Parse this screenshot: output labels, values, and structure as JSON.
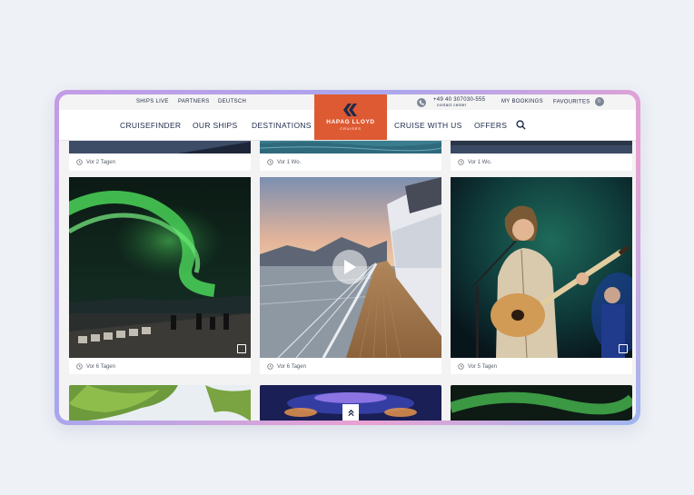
{
  "topbar": {
    "ships_live": "SHIPS LIVE",
    "partners": "PARTNERS",
    "language": "DEUTSCH",
    "phone_number": "+49 40 307030-555",
    "contact_center": "contact center",
    "my_bookings": "MY BOOKINGS",
    "favourites": "FAVOURITES",
    "favourites_count": "0"
  },
  "nav": {
    "cruisefinder": "CRUISEFINDER",
    "our_ships": "OUR SHIPS",
    "destinations": "DESTINATIONS",
    "cruise_with_us": "CRUISE WITH US",
    "offers": "OFFERS"
  },
  "logo": {
    "name": "HAPAG LLOYD",
    "sub": "CRUISES",
    "color": "#dd5a32"
  },
  "posts": {
    "row1": [
      "Vor 2 Tagen",
      "Vor 1 Wo.",
      "Vor 1 Wo."
    ],
    "row2": [
      "Vor 6 Tagen",
      "Vor 6 Tagen",
      "Vor 5 Tagen"
    ]
  },
  "icons": {
    "time": "clock-icon",
    "search": "search-icon",
    "phone": "phone-icon",
    "gallery": "gallery-icon",
    "play": "play-icon",
    "scroll_top": "chevron-double-up-icon"
  }
}
